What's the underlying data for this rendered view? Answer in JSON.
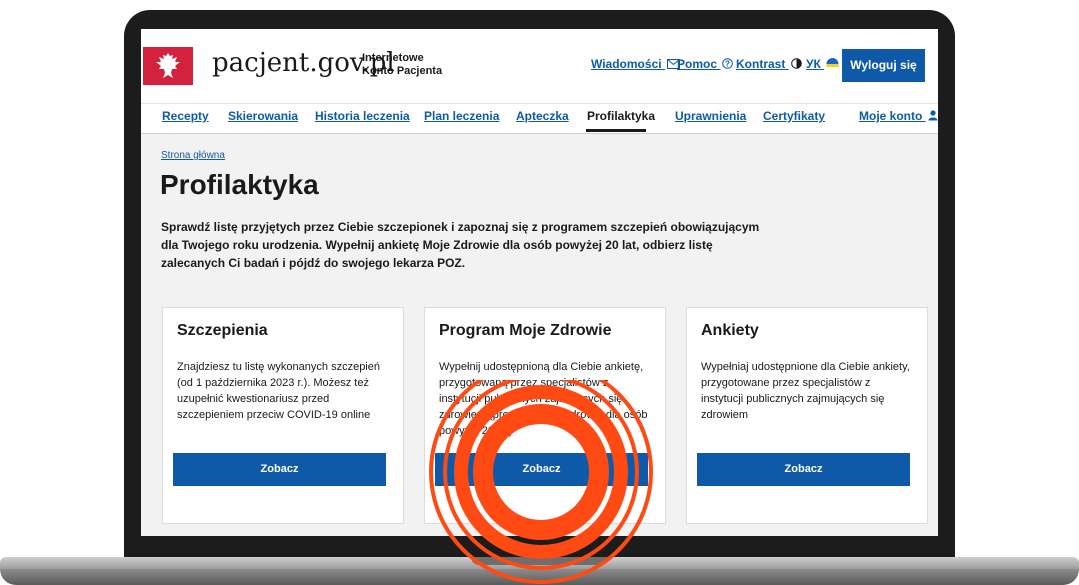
{
  "header": {
    "logo_text": "pacjent.gov.pl",
    "logo_sub_line1": "Internetowe",
    "logo_sub_line2": "Konto Pacjenta",
    "messages": "Wiadomości",
    "help": "Pomoc",
    "contrast": "Kontrast",
    "lang": "УК",
    "logout": "Wyloguj się"
  },
  "nav": {
    "items": [
      "Recepty",
      "Skierowania",
      "Historia leczenia",
      "Plan leczenia",
      "Apteczka",
      "Profilaktyka",
      "Uprawnienia",
      "Certyfikaty",
      "Moje konto"
    ],
    "active": "Profilaktyka"
  },
  "breadcrumb": "Strona główna",
  "page_title": "Profilaktyka",
  "intro": "Sprawdź listę przyjętych przez Ciebie szczepionek i zapoznaj się z programem szczepień obowiązującym dla Twojego roku urodzenia. Wypełnij ankietę Moje Zdrowie dla osób powyżej 20 lat, odbierz listę zalecanych Ci badań i pójdź do swojego lekarza POZ.",
  "cards": [
    {
      "title": "Szczepienia",
      "text": "Znajdziesz tu listę wykonanych szczepień (od 1 października 2023 r.). Możesz też uzupełnić kwestionariusz przed szczepieniem przeciw COVID-19 online",
      "button": "Zobacz"
    },
    {
      "title": "Program Moje Zdrowie",
      "text": "Wypełnij udostępnioną dla Ciebie ankietę, przygotowaną przez specjalistów z instytucji publicznych zajmujących się zdrowiem (program Moje Zdrowie dla osób powyżej 20 lat)",
      "button": "Zobacz"
    },
    {
      "title": "Ankiety",
      "text": "Wypełniaj udostępnione dla Ciebie ankiety, przygotowane przez specjalistów z instytucji publicznych zajmujących się zdrowiem",
      "button": "Zobacz"
    }
  ],
  "colors": {
    "accent": "#0f5aa8",
    "highlight": "#ff4a14",
    "logo_red": "#d4213d"
  }
}
